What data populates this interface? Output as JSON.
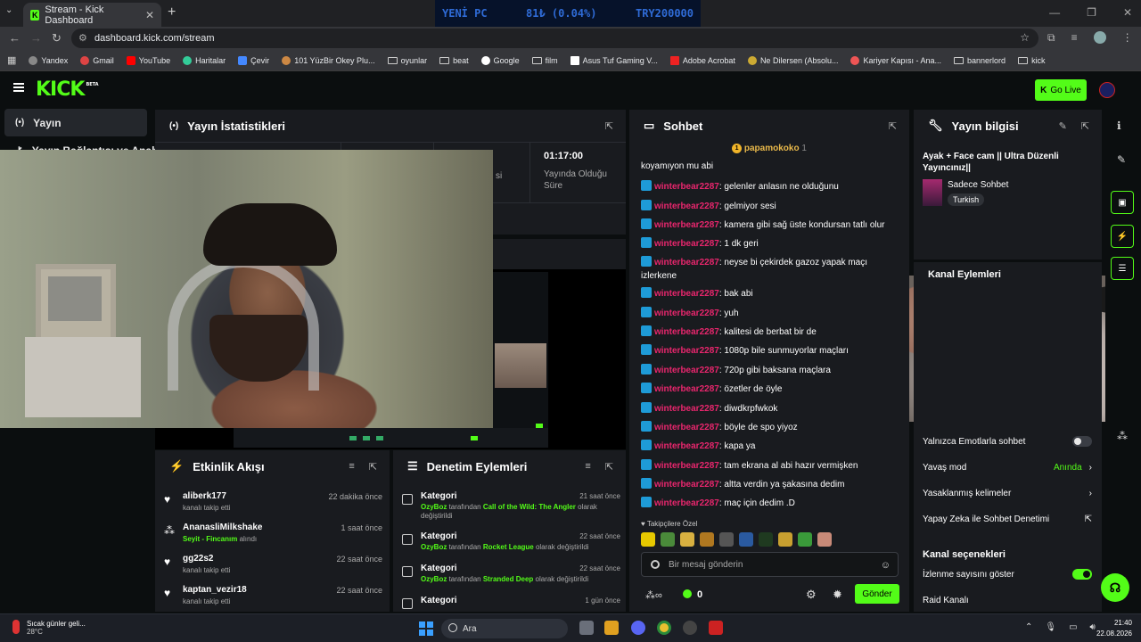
{
  "browser": {
    "tab_title": "Stream - Kick Dashboard",
    "url": "dashboard.kick.com/stream",
    "ticker": [
      "YENİ PC",
      "81₺ (0.04%)",
      "TRY200000"
    ],
    "bookmarks": [
      "Yandex",
      "Gmail",
      "YouTube",
      "Haritalar",
      "Çevir",
      "101 YüzBir Okey Plu...",
      "oyunlar",
      "beat",
      "Google",
      "film",
      "Asus Tuf Gaming V...",
      "Adobe Acrobat",
      "Ne Dilersen (Absolu...",
      "Kariyer Kapısı - Ana...",
      "bannerlord",
      "kick"
    ]
  },
  "kick": {
    "logo": "KICK",
    "logo_badge": "BETA",
    "go_live": "Go Live"
  },
  "sidebar": {
    "items": [
      "Yayın",
      "Yayın Bağlantısı ve Anahtar"
    ]
  },
  "stats": {
    "title": "Yayın İstatistikleri",
    "uptime_value": "01:17:00",
    "uptime_label": "Yayında Olduğu Süre",
    "partial_label": "si"
  },
  "activity": {
    "title": "Etkinlik Akışı",
    "rows": [
      {
        "name": "aliberk177",
        "desc": "kanalı takip etti",
        "time": "22 dakika önce"
      },
      {
        "name": "AnanasliMilkshake",
        "desc_green": "Seyit - Fincanım",
        "desc": " alındı",
        "time": "1 saat önce"
      },
      {
        "name": "gg22s2",
        "desc": "kanalı takip etti",
        "time": "22 saat önce"
      },
      {
        "name": "kaptan_vezir18",
        "desc": "kanalı takip etti",
        "time": "22 saat önce"
      }
    ]
  },
  "moderation": {
    "title": "Denetim Eylemleri",
    "rows": [
      {
        "name": "Kategori",
        "actor": "OzyBoz",
        "mid": " tarafından ",
        "target": "Call of the Wild: The Angler",
        "suffix": " olarak değiştirildi",
        "time": "21 saat önce"
      },
      {
        "name": "Kategori",
        "actor": "OzyBoz",
        "mid": " tarafından ",
        "target": "Rocket League",
        "suffix": " olarak değiştirildi",
        "time": "22 saat önce"
      },
      {
        "name": "Kategori",
        "actor": "OzyBoz",
        "mid": " tarafından ",
        "target": "Stranded Deep",
        "suffix": " olarak değiştirildi",
        "time": "22 saat önce"
      },
      {
        "name": "Kategori",
        "actor": "",
        "mid": "",
        "target": "",
        "suffix": "",
        "time": "1 gün önce"
      }
    ]
  },
  "chat": {
    "title": "Sohbet",
    "pinned_user": "papamokoko",
    "pinned_count": "1",
    "first_line": "koyamıyon mu abi",
    "username": "winterbear2287",
    "messages": [
      "gelenler anlasın ne olduğunu",
      "gelmiyor sesi",
      "kamera gibi sağ üste kondursan tatlı olur",
      "1 dk geri",
      "neyse bi çekirdek gazoz yapak maçı izlerkene",
      "bak abi",
      "yuh",
      "kalitesi de berbat bir de",
      "1080p bile sunmuyorlar maçları",
      "720p gibi baksana maçlara",
      "özetler de öyle",
      "diwdkrpfwkok",
      "böyle de spo yiyoz",
      "kapa ya",
      "tam ekrana al abi hazır vermişken",
      "altta verdin ya şakasına dedim",
      "maç için dedim .D"
    ],
    "emotes_label": "Takipçilere Özel",
    "input_placeholder": "Bir mesaj gönderin",
    "points": "0",
    "send": "Gönder"
  },
  "info": {
    "title": "Yayın bilgisi",
    "stream_title": "Ayak + Face cam || Ultra Düzenli Yayıncınız||",
    "category": "Sadece Sohbet",
    "language": "Turkish"
  },
  "channel": {
    "title": "Kanal Eylemleri",
    "settings": [
      {
        "label": "Yalnızca Emotlarla sohbet",
        "value": ""
      },
      {
        "label": "Yavaş mod",
        "value": "Anında"
      },
      {
        "label": "Yasaklanmış kelimeler",
        "value": ""
      },
      {
        "label": "Yapay Zeka ile Sohbet Denetimi",
        "value": ""
      }
    ],
    "section": "Kanal seçenekleri",
    "options": [
      {
        "label": "İzlenme sayısını göster"
      },
      {
        "label": "Raid Kanalı"
      }
    ]
  },
  "taskbar": {
    "weather_line1": "Sıcak günler geli...",
    "weather_line2": "28°C",
    "search": "Ara",
    "time": "21:40",
    "date": "22.08.2026"
  },
  "colors": {
    "kick_green": "#53fc18",
    "chat_user": "#e8266d",
    "panel": "#191b1f"
  }
}
